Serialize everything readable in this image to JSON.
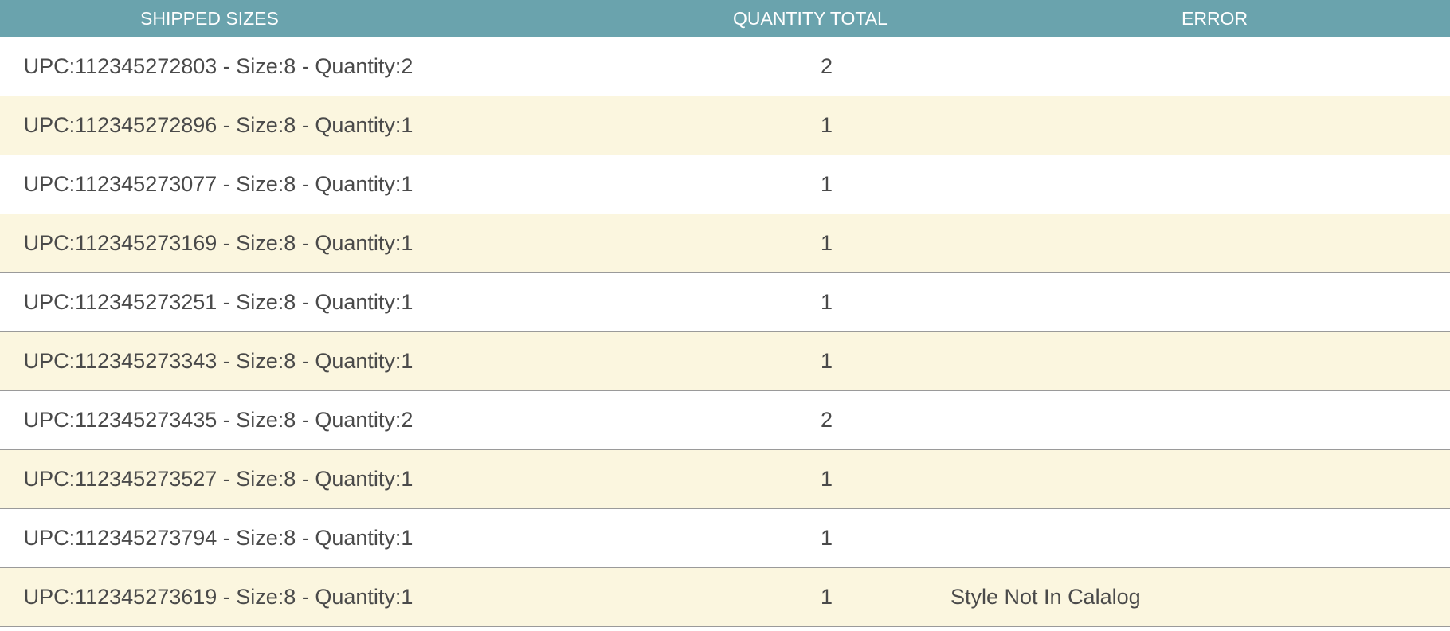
{
  "colors": {
    "header_bg": "#6aa3ad",
    "row_alt_bg": "#fbf6df",
    "row_bg": "#ffffff",
    "text": "#4a4a4a",
    "border": "#9a9a9a"
  },
  "table": {
    "headers": {
      "shipped_sizes": "SHIPPED SIZES",
      "quantity_total": "QUANTITY TOTAL",
      "error": "ERROR"
    },
    "rows": [
      {
        "shipped": "UPC:112345272803 - Size:8 - Quantity:2",
        "qty": "2",
        "error": ""
      },
      {
        "shipped": "UPC:112345272896 - Size:8 - Quantity:1",
        "qty": "1",
        "error": ""
      },
      {
        "shipped": "UPC:112345273077 - Size:8 - Quantity:1",
        "qty": "1",
        "error": ""
      },
      {
        "shipped": "UPC:112345273169 - Size:8 - Quantity:1",
        "qty": "1",
        "error": ""
      },
      {
        "shipped": "UPC:112345273251 - Size:8 - Quantity:1",
        "qty": "1",
        "error": ""
      },
      {
        "shipped": "UPC:112345273343 - Size:8 - Quantity:1",
        "qty": "1",
        "error": ""
      },
      {
        "shipped": "UPC:112345273435 - Size:8 - Quantity:2",
        "qty": "2",
        "error": ""
      },
      {
        "shipped": "UPC:112345273527 - Size:8 - Quantity:1",
        "qty": "1",
        "error": ""
      },
      {
        "shipped": "UPC:112345273794 - Size:8 - Quantity:1",
        "qty": "1",
        "error": ""
      },
      {
        "shipped": "UPC:112345273619 - Size:8 - Quantity:1",
        "qty": "1",
        "error": "Style Not In Calalog"
      }
    ]
  }
}
